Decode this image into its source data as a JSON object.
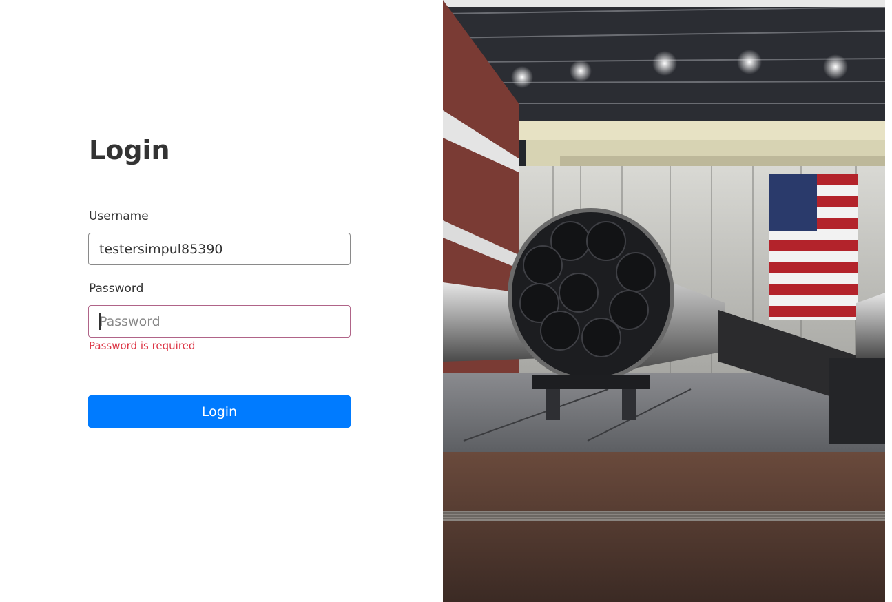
{
  "login": {
    "title": "Login",
    "username_label": "Username",
    "username_value": "testersimpul85390",
    "password_label": "Password",
    "password_placeholder": "Password",
    "password_error": "Password is required",
    "submit_label": "Login"
  },
  "hero_image": {
    "flag_icon": "us-flag-icon",
    "colors": {
      "accent": "#007bff",
      "error": "#dc3545"
    }
  }
}
